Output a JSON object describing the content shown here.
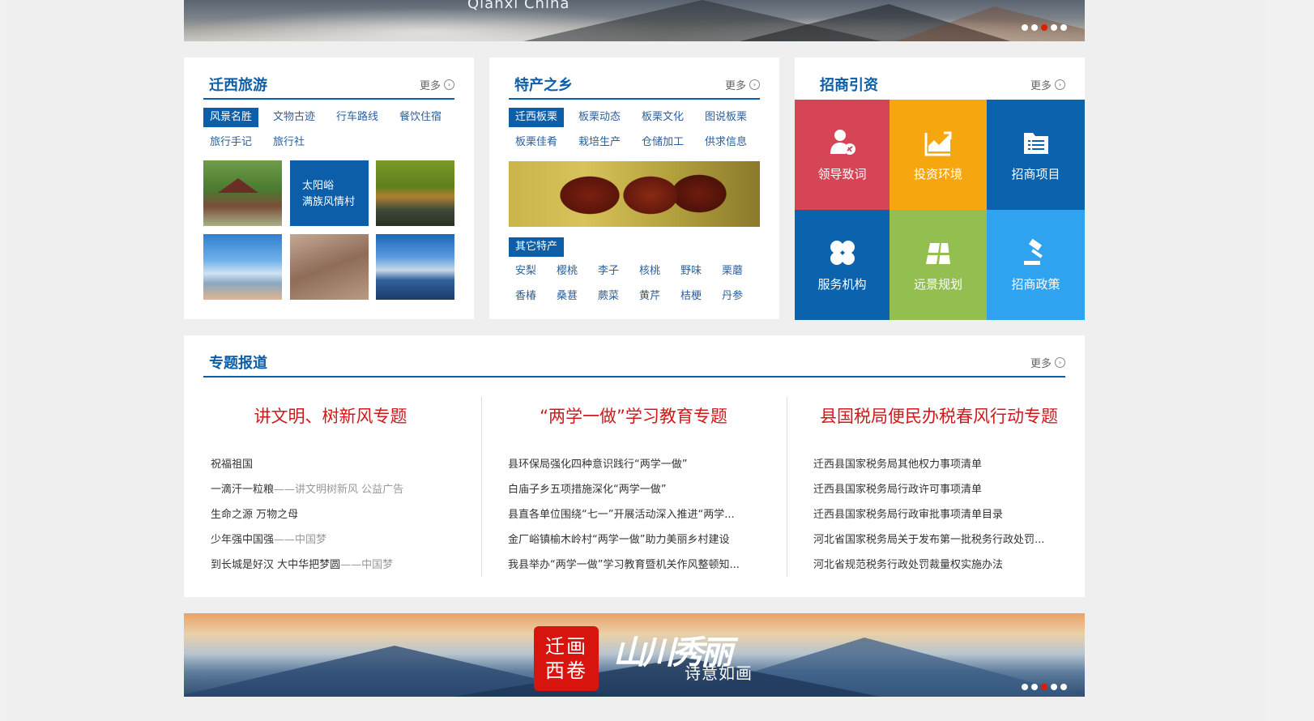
{
  "banner_top": {
    "caption": "Qianxi China",
    "slides": 5,
    "active_slide": 3
  },
  "tourism": {
    "title": "迁西旅游",
    "more": "更多",
    "tabs": [
      "风景名胜",
      "文物古迹",
      "行车路线",
      "餐饮住宿",
      "旅行手记",
      "旅行社"
    ],
    "active_tab": "风景名胜",
    "feature_line1": "太阳峪",
    "feature_line2": "满族风情村"
  },
  "specialty": {
    "title": "特产之乡",
    "more": "更多",
    "tabs": [
      "迁西板栗",
      "板栗动态",
      "板栗文化",
      "图说板栗",
      "板栗佳肴",
      "栽培生产",
      "仓储加工",
      "供求信息"
    ],
    "active_tab": "迁西板栗",
    "other_label": "其它特产",
    "products": [
      "安梨",
      "樱桃",
      "李子",
      "核桃",
      "野味",
      "栗蘑",
      "香椿",
      "桑葚",
      "蕨菜",
      "黄芹",
      "桔梗",
      "丹参"
    ]
  },
  "investment": {
    "title": "招商引资",
    "more": "更多",
    "tiles": [
      {
        "label": "领导致词",
        "color": "#d64556",
        "icon": "leader-icon"
      },
      {
        "label": "投资环境",
        "color": "#f6a60f",
        "icon": "chart-icon"
      },
      {
        "label": "招商项目",
        "color": "#0b62ad",
        "icon": "folder-list-icon"
      },
      {
        "label": "服务机构",
        "color": "#0b62ad",
        "icon": "four-leaf-icon"
      },
      {
        "label": "远景规划",
        "color": "#92bf4f",
        "icon": "blueprint-icon"
      },
      {
        "label": "招商政策",
        "color": "#2fa3f0",
        "icon": "gavel-icon"
      }
    ]
  },
  "topics": {
    "title": "专题报道",
    "more": "更多",
    "columns": [
      {
        "title": "讲文明、树新风专题",
        "items": [
          {
            "main": "祝福祖国",
            "sub": ""
          },
          {
            "main": "一滴汗一粒粮",
            "sub": "——讲文明树新风 公益广告"
          },
          {
            "main": "生命之源 万物之母",
            "sub": ""
          },
          {
            "main": "少年强中国强",
            "sub": "——中国梦"
          },
          {
            "main": "到长城是好汉 大中华把梦圆",
            "sub": "——中国梦"
          }
        ]
      },
      {
        "title": "“两学一做”学习教育专题",
        "items": [
          {
            "main": "县环保局强化四种意识践行“两学一做”",
            "sub": ""
          },
          {
            "main": "白庙子乡五项措施深化“两学一做”",
            "sub": ""
          },
          {
            "main": "县直各单位围绕“七一”开展活动深入推进“两学...",
            "sub": ""
          },
          {
            "main": "金厂峪镇榆木岭村“两学一做”助力美丽乡村建设",
            "sub": ""
          },
          {
            "main": "我县举办“两学一做”学习教育暨机关作风整顿知...",
            "sub": ""
          }
        ]
      },
      {
        "title": "县国税局便民办税春风行动专题",
        "items": [
          {
            "main": "迁西县国家税务局其他权力事项清单",
            "sub": ""
          },
          {
            "main": "迁西县国家税务局行政许可事项清单",
            "sub": ""
          },
          {
            "main": "迁西县国家税务局行政审批事项清单目录",
            "sub": ""
          },
          {
            "main": "河北省国家税务局关于发布第一批税务行政处罚...",
            "sub": ""
          },
          {
            "main": "河北省规范税务行政处罚裁量权实施办法",
            "sub": ""
          }
        ]
      }
    ]
  },
  "banner_bottom": {
    "seal_line1": "迁画",
    "seal_line2": "西卷",
    "callig": "山川秀丽",
    "slogan": "诗意如画",
    "slides": 5,
    "active_slide": 3
  },
  "colors": {
    "primary": "#0c5ea8",
    "topic_red": "#d0191c",
    "dot_active": "#d81e06"
  }
}
